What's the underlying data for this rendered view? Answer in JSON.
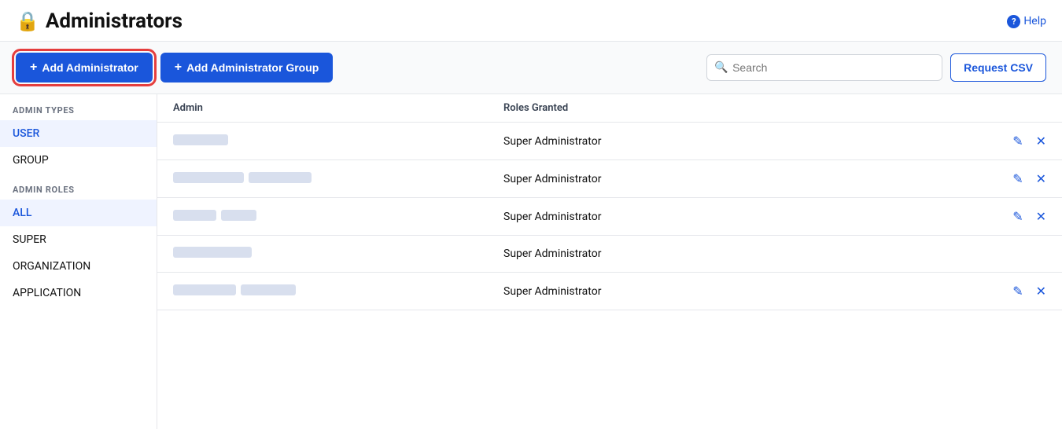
{
  "header": {
    "title": "Administrators",
    "help_label": "Help"
  },
  "toolbar": {
    "add_admin_label": "Add Administrator",
    "add_group_label": "Add Administrator Group",
    "search_placeholder": "Search",
    "csv_label": "Request CSV"
  },
  "sidebar": {
    "admin_types_label": "ADMIN TYPES",
    "admin_roles_label": "ADMIN ROLES",
    "type_items": [
      {
        "label": "USER",
        "active": true
      },
      {
        "label": "GROUP",
        "active": false
      }
    ],
    "role_items": [
      {
        "label": "ALL",
        "active": true
      },
      {
        "label": "SUPER",
        "active": false
      },
      {
        "label": "ORGANIZATION",
        "active": false
      },
      {
        "label": "APPLICATION",
        "active": false
      }
    ]
  },
  "table": {
    "col_admin": "Admin",
    "col_roles": "Roles Granted",
    "rows": [
      {
        "id": 1,
        "name_widths": [
          70
        ],
        "role": "Super Administrator",
        "has_actions": true
      },
      {
        "id": 2,
        "name_widths": [
          90,
          80
        ],
        "role": "Super Administrator",
        "has_actions": true
      },
      {
        "id": 3,
        "name_widths": [
          55,
          45
        ],
        "role": "Super Administrator",
        "has_actions": true
      },
      {
        "id": 4,
        "name_widths": [
          100
        ],
        "role": "Super Administrator",
        "has_actions": false
      },
      {
        "id": 5,
        "name_widths": [
          80,
          70
        ],
        "role": "Super Administrator",
        "has_actions": true
      }
    ]
  },
  "colors": {
    "accent": "#1a56db",
    "active_bg": "#eff3ff",
    "border": "#e5e7eb",
    "blur_block": "#c7d2e7"
  }
}
